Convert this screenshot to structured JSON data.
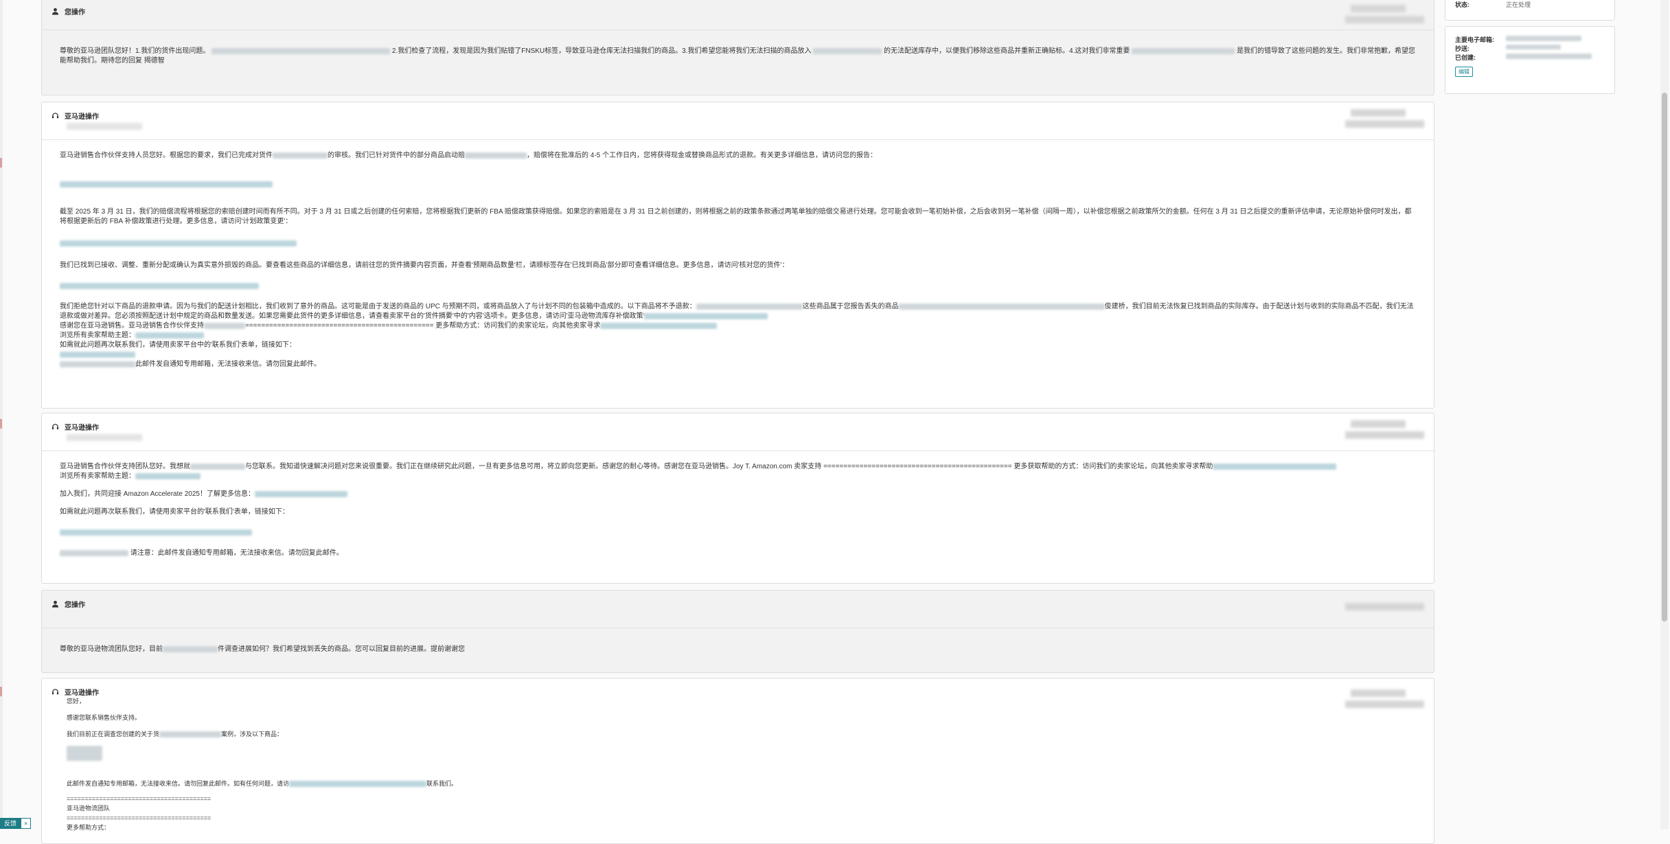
{
  "thread": {
    "card1": {
      "author": "您操作",
      "text_a": "尊敬的亚马逊团队您好！1.我们的货件出现问题。",
      "text_b": "2.我们检查了流程，发现是因为我们贴错了FNSKU标签，导致亚马逊仓库无法扫描我们的商品。3.我们希望您能将我们无法扫描的商品放入",
      "text_c": "的无法配送库存中，以便我们移除这些商品并重新正确贴标。4.这对我们非常重要",
      "text_d": "是我们的错导致了这些问题的发生。我们非常抱歉，希望您能帮助我们。期待您的回复 揭德智"
    },
    "card2": {
      "author": "亚马逊操作",
      "p1a": "亚马逊销售合作伙伴支持人员您好。根据您的要求，我们已完成对货件",
      "p1b": "的审核。我们已针对货件中的部分商品启动赔",
      "p1c": "，赔偿将在批准后的 4-5 个工作日内，您将获得现金或替换商品形式的退款。有关更多详细信息，请访问您的报告：",
      "p2": "截至 2025 年 3 月 31 日，我们的赔偿流程将根据您的索赔创建时间而有所不同。对于 3 月 31 日或之后创建的任何索赔，您将根据我们更新的 FBA 赔偿政策获得赔偿。如果您的索赔是在 3 月 31 日之前创建的，则将根据之前的政策条款通过两笔单独的赔偿交易进行处理。您可能会收到一笔初始补偿，之后会收到另一笔补偿（间隔一周），以补偿您根据之前政策所欠的金额。任何在 3 月 31 日之后提交的重新评估申请，无论原始补偿何时发出，都将根据更新后的 FBA 补偿政策进行处理。更多信息，请访问'计划政策变更'：",
      "p3": "我们已找到已接收、调整、重新分配或确认为真实意外损毁的商品。要查看这些商品的详细信息，请前往您的货件摘要内容页面，并查看'预期商品数量'栏，请顺标签存在'已找到商品'部分即可查看详细信息。更多信息，请访问'核对您的货件'：",
      "p4a": "我们拒绝您针对以下商品的退款申请。因为与我们的配送计划相比，我们收到了意外的商品。这可能是由于发送的商品的 UPC 与预期不同，或将商品放入了与计划不同的包装箱中造成的。以下商品将不予退款：",
      "p4b": "这些商品属于您报告丢失的商品",
      "p4c": "俊建桥，我们目前无法恢复已找到商品的实际库存。由于配送计划与收到的实际商品不匹配，我们无法退款或做对差异。您必须按照配送计划中规定的商品和数量发送。如果您需要此货件的更多详细信息，请查看卖家平台的'货件摘要'中的'内容'选项卡。更多信息，请访问'亚马逊物流库存补偿政策'",
      "p5a": "感谢您在亚马逊销售。亚马逊销售合作伙伴支持",
      "p5b": "=============================================== 更多帮助方式：访问我们的卖家论坛，向其他卖家寻求",
      "p5c": "浏览所有卖家帮助主题：",
      "p6": "如需就此问题再次联系我们，请使用卖家平台中的'联系我们'表单，链接如下：",
      "p7": "此邮件发自通知专用邮箱，无法接收来信。请勿回复此邮件。"
    },
    "card3": {
      "author": "亚马逊操作",
      "p1a": "亚马逊销售合作伙伴支持团队您好。我想就",
      "p1b": "与您联系。我知道快速解决问题对您来说很重要。我们正在继续研究此问题，一旦有更多信息可用，将立即向您更新。感谢您的耐心等待。感谢您在亚马逊销售。Joy T. Amazon.com 卖家支持 =============================================== 更多获取帮助的方式：访问我们的卖家论坛，向其他卖家寻求帮助",
      "p1c": "浏览所有卖家帮助主题：",
      "p2": "加入我们，共同迎接 Amazon Accelerate 2025！了解更多信息：",
      "p3": "如需就此问题再次联系我们，请使用卖家平台的'联系我们'表单，链接如下：",
      "p4": "请注意：此邮件发自通知专用邮箱，无法接收来信。请勿回复此邮件。"
    },
    "card4": {
      "author": "您操作",
      "text_a": "尊敬的亚马逊物流团队您好，目前",
      "text_b": "件调查进展如何？我们希望找到丢失的商品。您可以回复目前的进展。提前谢谢您"
    },
    "card5": {
      "author": "亚马逊操作",
      "l1": "您好，",
      "l2": "感谢您联系销售伙伴支持。",
      "l3a": "我们目前正在调查您创建的关于货",
      "l3b": "案例，涉及以下商品：",
      "l4a": "此邮件发自通知专用邮箱，无法接收来信。请勿回复此邮件。如有任何问题，请访",
      "l4b": "联系我们。",
      "l5": "========================================",
      "l6": "亚马逊物流团队",
      "l7": "========================================",
      "l8": "更多帮助方式："
    }
  },
  "side": {
    "status_label": "状态:",
    "status_value": "正在处理",
    "email_label": "主要电子邮箱:",
    "cc_label": "抄送:",
    "created_label": "已创建:",
    "edit_label": "编辑"
  },
  "feedback": {
    "label": "反馈",
    "close": "×"
  }
}
